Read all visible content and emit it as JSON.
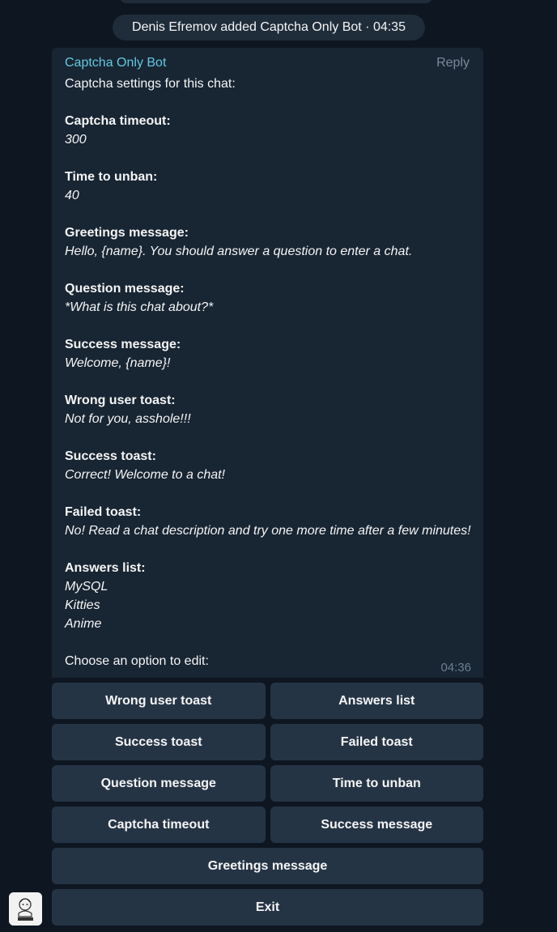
{
  "service_message": "Denis Efremov added Captcha Only Bot · 04:35",
  "message": {
    "sender": "Captcha Only Bot",
    "reply_label": "Reply",
    "intro": "Captcha settings for this chat:",
    "sections": [
      {
        "label": "Captcha timeout:",
        "values": [
          "300"
        ]
      },
      {
        "label": "Time to unban:",
        "values": [
          "40"
        ]
      },
      {
        "label": "Greetings message:",
        "values": [
          "Hello, {name}. You should answer a question to enter a chat."
        ]
      },
      {
        "label": "Question message:",
        "values": [
          "*What is this chat about?*"
        ]
      },
      {
        "label": "Success message:",
        "values": [
          "Welcome, {name}!"
        ]
      },
      {
        "label": "Wrong user toast:",
        "values": [
          "Not for you, asshole!!!"
        ]
      },
      {
        "label": "Success toast:",
        "values": [
          "Correct! Welcome to a chat!"
        ]
      },
      {
        "label": "Failed toast:",
        "values": [
          "No! Read a chat description and try one more time after a few minutes!"
        ]
      },
      {
        "label": "Answers list:",
        "values": [
          "MySQL",
          "Kitties",
          "Anime"
        ]
      }
    ],
    "outro": "Choose an option to edit:",
    "time": "04:36"
  },
  "keyboard": [
    [
      "Wrong user toast",
      "Answers list"
    ],
    [
      "Success toast",
      "Failed toast"
    ],
    [
      "Question message",
      "Time to unban"
    ],
    [
      "Captcha timeout",
      "Success message"
    ],
    [
      "Greetings message"
    ],
    [
      "Exit"
    ]
  ],
  "colors": {
    "background": "#0e1621",
    "bubble": "#182533",
    "button": "#253445",
    "sender": "#63c9e0"
  }
}
